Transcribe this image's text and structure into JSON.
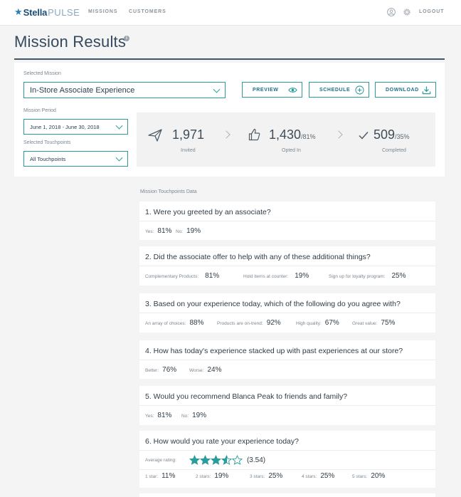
{
  "nav": {
    "logo_brand": "Stella",
    "logo_suffix": "PULSE",
    "missions": "MISSIONS",
    "customers": "CUSTOMERS",
    "logout": "LOGOUT"
  },
  "page": {
    "title": "Mission Results",
    "info": "i"
  },
  "filters": {
    "mission_label": "Selected Mission",
    "mission_value": "In-Store Associate Experience",
    "period_label": "Mission Period",
    "period_value": "June 1, 2018 - June 30, 2018",
    "touchpoints_label": "Selected Touchpoints",
    "touchpoints_value": "All Touchpoints"
  },
  "actions": {
    "preview": "PREVIEW",
    "schedule": "SCHEDULE",
    "download": "DOWNLOAD"
  },
  "stats": {
    "invited_value": "1,971",
    "invited_label": "Invited",
    "opted_value": "1,430",
    "opted_pct": "/81%",
    "opted_label": "Opted In",
    "completed_value": "509",
    "completed_pct": "/35%",
    "completed_label": "Completed"
  },
  "touchpoints": {
    "section_label": "Mission Touchpoints Data",
    "questions": [
      {
        "q": "1. Were you greeted by an associate?",
        "answers": [
          {
            "label": "Yes:",
            "value": "81%"
          },
          {
            "label": "No:",
            "value": "19%"
          }
        ]
      },
      {
        "q": "2. Did the associate offer to help with any of these additional things?",
        "answers": [
          {
            "label": "Complementary Products:",
            "value": "81%"
          },
          {
            "label": "Hold items at counter:",
            "value": "19%"
          },
          {
            "label": "Sign up for loyalty program:",
            "value": "25%"
          }
        ]
      },
      {
        "q": "3. Based on your experience today, which of the following do you agree with?",
        "answers": [
          {
            "label": "An array of choices:",
            "value": "88%"
          },
          {
            "label": "Products are on-trend:",
            "value": "92%"
          },
          {
            "label": "High quality:",
            "value": "67%"
          },
          {
            "label": "Great value:",
            "value": "75%"
          }
        ]
      },
      {
        "q": "4. How has today's experience stacked up with past experiences at our store?",
        "answers": [
          {
            "label": "Better:",
            "value": "76%"
          },
          {
            "label": "Worse:",
            "value": "24%"
          }
        ]
      },
      {
        "q": "5. Would you recommend Blanca Peak to friends and family?",
        "answers": [
          {
            "label": "Yes:",
            "value": "81%"
          },
          {
            "label": "No:",
            "value": "19%"
          }
        ]
      },
      {
        "q": "6. How would you rate your experience today?",
        "rating_label": "Average rating:",
        "rating_value": "(3.54)",
        "rating": 3.54,
        "answers": [
          {
            "label": "1 star:",
            "value": "11%"
          },
          {
            "label": "2 stars:",
            "value": "19%"
          },
          {
            "label": "3 stars:",
            "value": "25%"
          },
          {
            "label": "4 stars:",
            "value": "25%"
          },
          {
            "label": "5 stars:",
            "value": "20%"
          }
        ]
      }
    ]
  },
  "colors": {
    "accent": "#2a9d9a",
    "star": "#2a9d9a",
    "title_rule": "#42566a"
  }
}
